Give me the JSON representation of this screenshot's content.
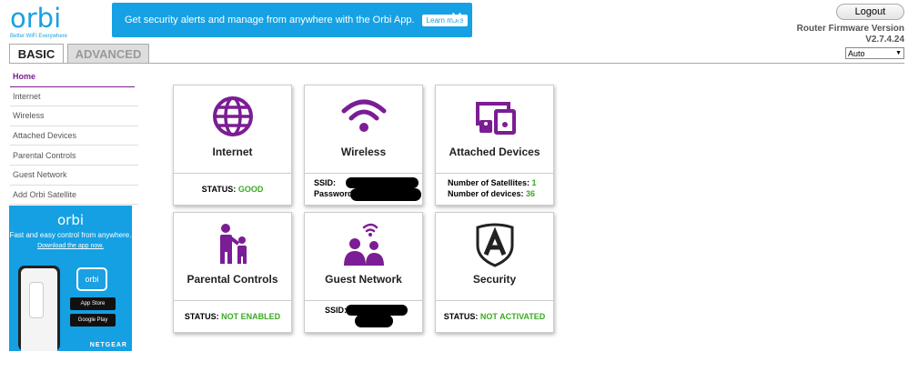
{
  "logo": {
    "word": "orbi",
    "tagline": "Better WiFi Everywhere"
  },
  "banner": {
    "text": "Get security alerts and manage from anywhere with the Orbi App.",
    "button": "Learn more",
    "close": "✕"
  },
  "tabs": {
    "basic": "BASIC",
    "advanced": "ADVANCED"
  },
  "header": {
    "logout": "Logout",
    "firmware_label": "Router Firmware Version",
    "firmware_version": "V2.7.4.24",
    "language": "Auto"
  },
  "nav": [
    {
      "label": "Home"
    },
    {
      "label": "Internet"
    },
    {
      "label": "Wireless"
    },
    {
      "label": "Attached Devices"
    },
    {
      "label": "Parental Controls"
    },
    {
      "label": "Guest Network"
    },
    {
      "label": "Add Orbi Satellite"
    }
  ],
  "ad": {
    "logo": "orbi",
    "text": "Fast and easy control from anywhere.",
    "link": "Download the app now.",
    "app_icon": "orbi",
    "app_store": "App Store",
    "google_play": "Google Play",
    "brand": "NETGEAR"
  },
  "cards": {
    "internet": {
      "title": "Internet",
      "status_label": "STATUS:",
      "status_value": "GOOD"
    },
    "wireless": {
      "title": "Wireless",
      "ssid_label": "SSID:",
      "password_label": "Password:"
    },
    "attached": {
      "title": "Attached Devices",
      "satellites_label": "Number of Satellites:",
      "satellites_value": "1",
      "devices_label": "Number of devices:",
      "devices_value": "36"
    },
    "parental": {
      "title": "Parental Controls",
      "status_label": "STATUS:",
      "status_value": "NOT ENABLED"
    },
    "guest": {
      "title": "Guest Network",
      "ssid_label": "SSID:"
    },
    "security": {
      "title": "Security",
      "status_label": "STATUS:",
      "status_value": "NOT ACTIVATED"
    }
  },
  "colors": {
    "accent_purple": "#7b1d94",
    "brand_blue": "#16a1e4",
    "status_green": "#3aaa24"
  }
}
